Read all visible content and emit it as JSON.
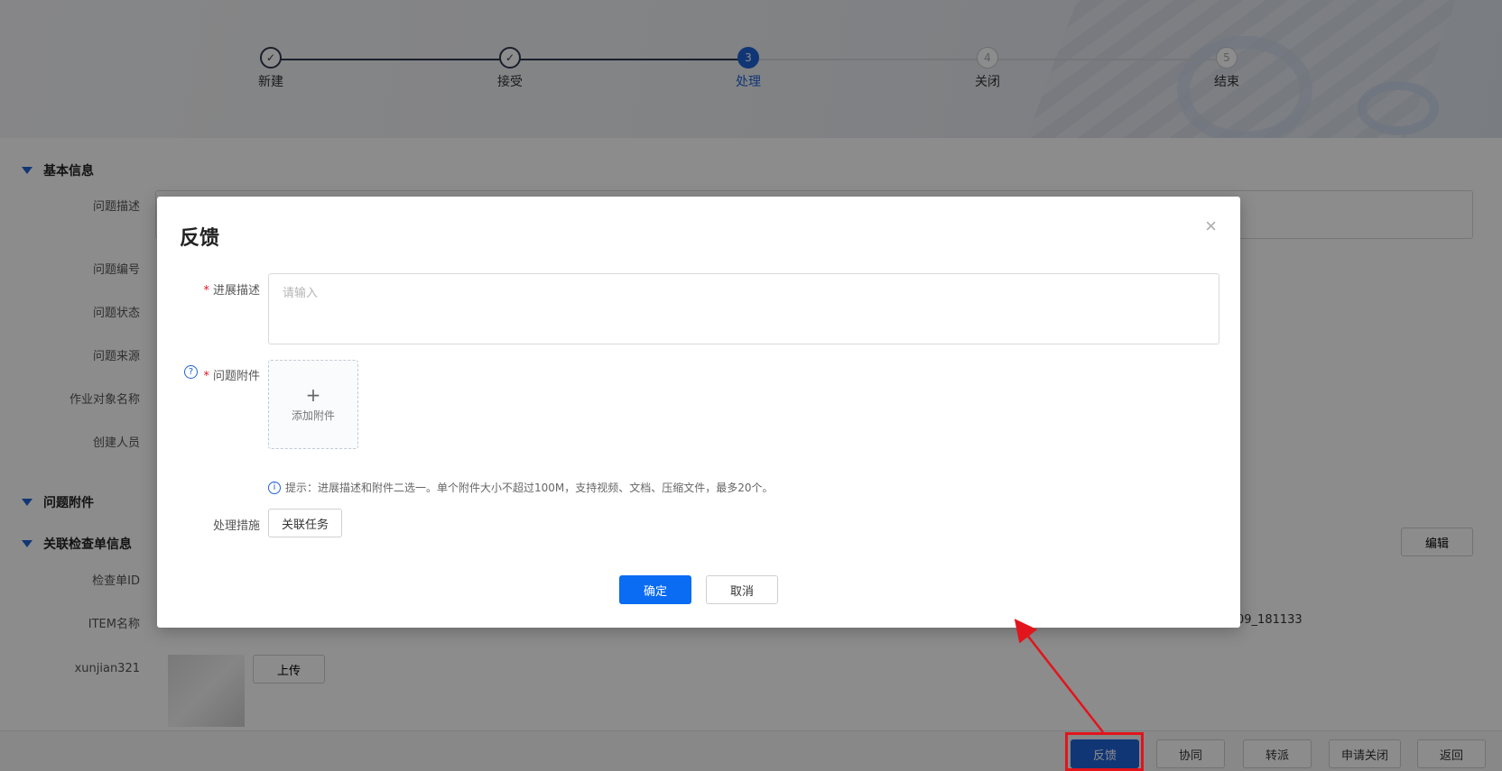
{
  "steps": [
    {
      "label": "新建",
      "status": "done",
      "number": ""
    },
    {
      "label": "接受",
      "status": "done",
      "number": ""
    },
    {
      "label": "处理",
      "status": "active",
      "number": "3"
    },
    {
      "label": "关闭",
      "status": "pending",
      "number": "4"
    },
    {
      "label": "结束",
      "status": "pending",
      "number": "5"
    }
  ],
  "page": {
    "section_basic": "基本信息",
    "labels": {
      "desc": "问题描述",
      "code": "问题编号",
      "status": "问题状态",
      "source": "问题来源",
      "object": "作业对象名称",
      "creator": "创建人员"
    },
    "section_attach": "问题附件",
    "section_check": "关联检查单信息",
    "edit": "编辑",
    "check_id": "检查单ID",
    "item_name": "ITEM名称",
    "item_value_partial": "09_181133",
    "user": "xunjian321",
    "upload": "上传"
  },
  "bottom": {
    "feedback": "反馈",
    "cooperate": "协同",
    "transfer": "转派",
    "apply_close": "申请关闭",
    "back": "返回"
  },
  "modal": {
    "title": "反馈",
    "close": "×",
    "progress_label": "进展描述",
    "progress_placeholder": "请输入",
    "attach_label": "问题附件",
    "add_attach_plus": "+",
    "add_attach": "添加附件",
    "hint": "提示：进展描述和附件二选一。单个附件大小不超过100M，支持视频、文档、压缩文件，最多20个。",
    "measure_label": "处理措施",
    "link_task": "关联任务",
    "ok": "确定",
    "cancel": "取消",
    "required_mark": "*",
    "help_mark": "?",
    "info_mark": "i"
  },
  "colors": {
    "primary": "#1f63d6",
    "highlight": "#e2141c"
  }
}
